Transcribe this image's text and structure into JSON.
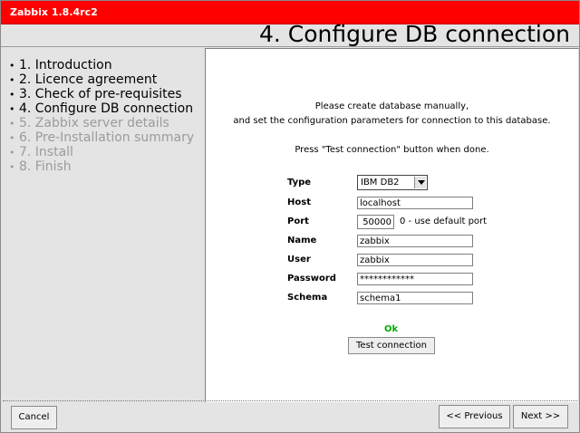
{
  "window": {
    "title": "Zabbix 1.8.4rc2"
  },
  "header": {
    "title": "4. Configure DB connection"
  },
  "steps": [
    {
      "label": "1. Introduction",
      "state": "done"
    },
    {
      "label": "2. Licence agreement",
      "state": "done"
    },
    {
      "label": "3. Check of pre-requisites",
      "state": "done"
    },
    {
      "label": "4. Configure DB connection",
      "state": "current"
    },
    {
      "label": "5. Zabbix server details",
      "state": "pending"
    },
    {
      "label": "6. Pre-Installation summary",
      "state": "pending"
    },
    {
      "label": "7. Install",
      "state": "pending"
    },
    {
      "label": "8. Finish",
      "state": "pending"
    }
  ],
  "intro": {
    "line1": "Please create database manually,",
    "line2": "and set the configuration parameters for connection to this database.",
    "line3": "Press \"Test connection\" button when done."
  },
  "form": {
    "type_label": "Type",
    "type_value": "IBM DB2",
    "host_label": "Host",
    "host_value": "localhost",
    "port_label": "Port",
    "port_value": "50000",
    "port_note": "0 - use default port",
    "name_label": "Name",
    "name_value": "zabbix",
    "user_label": "User",
    "user_value": "zabbix",
    "password_label": "Password",
    "password_value": "************",
    "schema_label": "Schema",
    "schema_value": "schema1"
  },
  "status": {
    "text": "Ok",
    "color": "#00aa00"
  },
  "buttons": {
    "test": "Test connection",
    "cancel": "Cancel",
    "previous": "<< Previous",
    "next": "Next >>"
  },
  "colors": {
    "titlebar": "#ff0000",
    "panel": "#e4e4e4",
    "disabled_step": "#9b9b9b"
  }
}
